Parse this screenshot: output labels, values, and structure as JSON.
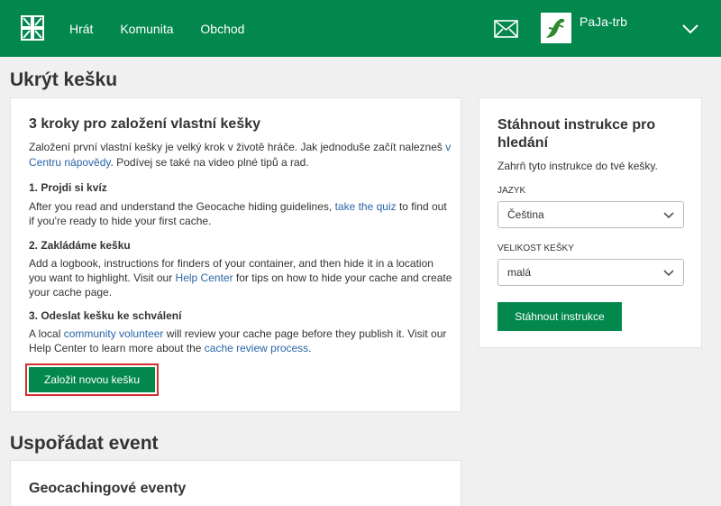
{
  "header": {
    "nav": [
      "Hrát",
      "Komunita",
      "Obchod"
    ],
    "username": "PaJa-trb"
  },
  "page_title": "Ukrýt kešku",
  "main": {
    "title": "3 kroky pro založení vlastní kešky",
    "intro_before": "Založení první vlastní kešky je velký krok v životě hráče. Jak jednoduše začít nalezneš ",
    "intro_link": "v Centru nápovědy",
    "intro_after": ". Podívej se také na video plné tipů a rad.",
    "step1_title": "1. Projdi si kvíz",
    "step1_before": "After you read and understand the Geocache hiding guidelines, ",
    "step1_link": "take the quiz",
    "step1_after": " to find out if you're ready to hide your first cache.",
    "step2_title": "2. Zakládáme kešku",
    "step2_before": "Add a logbook, instructions for finders of your container, and then hide it in a location you want to highlight. Visit our ",
    "step2_link": "Help Center",
    "step2_after": " for tips on how to hide your cache and create your cache page.",
    "step3_title": "3. Odeslat kešku ke schválení",
    "step3_before": "A local ",
    "step3_link1": "community volunteer",
    "step3_middle": " will review your cache page before they publish it. Visit our Help Center to learn more about the ",
    "step3_link2": "cache review process",
    "step3_after": ".",
    "create_button": "Založit novou kešku"
  },
  "side": {
    "title": "Stáhnout instrukce pro hledání",
    "text": "Zahrň tyto instrukce do tvé kešky.",
    "language_label": "Jazyk",
    "language_value": "Čeština",
    "size_label": "Velikost kešky",
    "size_value": "malá",
    "download_button": "Stáhnout instrukce"
  },
  "event": {
    "page_title": "Uspořádat event",
    "card_title": "Geocachingové eventy"
  }
}
